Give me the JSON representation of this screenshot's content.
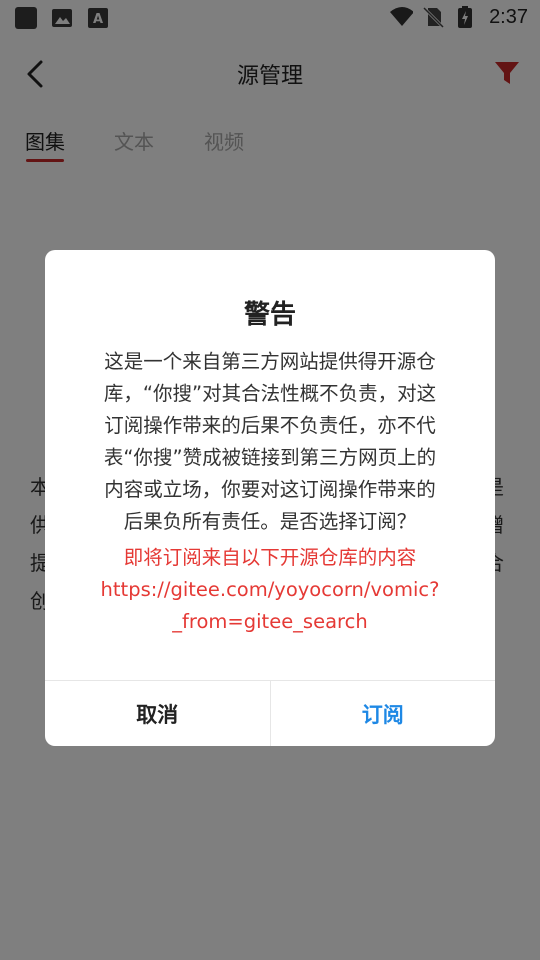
{
  "status_bar": {
    "time": "2:37",
    "left_icons": [
      "app-icon",
      "image-icon",
      "font-icon"
    ],
    "right_icons": [
      "wifi-icon",
      "no-sim-icon",
      "battery-charging-icon"
    ]
  },
  "appbar": {
    "title": "源管理",
    "back_icon": "back-arrow-icon",
    "filter_icon": "filter-icon",
    "accent_color": "#c62828"
  },
  "tabs": [
    {
      "label": "图集",
      "active": true
    },
    {
      "label": "文本",
      "active": false
    },
    {
      "label": "视频",
      "active": false
    }
  ],
  "background_text": {
    "lines": [
      "本",
      "供",
      "提",
      "创"
    ],
    "right_fragments": [
      "是",
      "赠",
      "合"
    ]
  },
  "dialog": {
    "title": "警告",
    "body_lines": [
      "这是一个来自第三方网站提供得开源仓",
      "库，“你搜”对其合法性概不负责，对这",
      "订阅操作带来的后果不负责任，亦不代",
      "表“你搜”赞成被链接到第三方网页上的",
      "内容或立场，你要对这订阅操作带来的",
      "后果负所有责任。是否选择订阅？"
    ],
    "notice": "即将订阅来自以下开源仓库的内容",
    "url_lines": [
      "https://gitee.com/yoyocorn/vomic?",
      "_from=gitee_search"
    ],
    "cancel_label": "取消",
    "confirm_label": "订阅",
    "confirm_color": "#1e88e5",
    "notice_color": "#e53935"
  }
}
